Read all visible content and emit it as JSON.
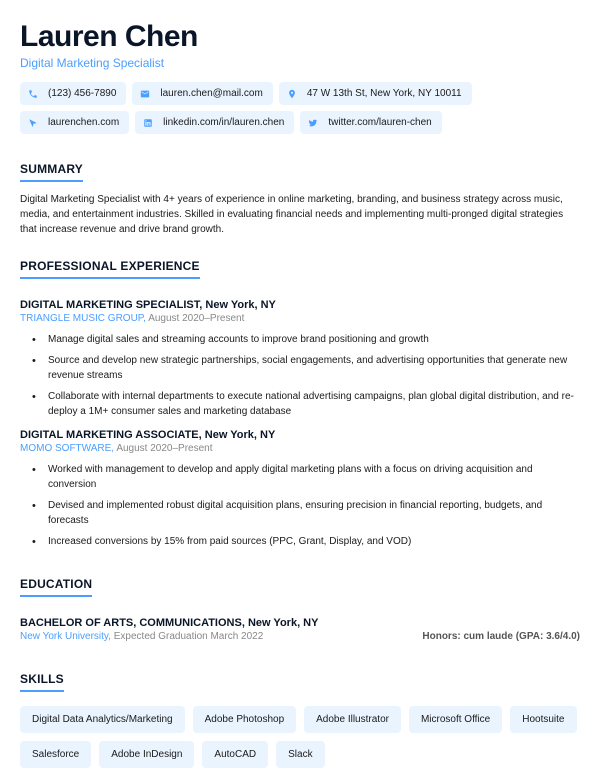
{
  "header": {
    "name": "Lauren Chen",
    "title": "Digital Marketing Specialist"
  },
  "contact": {
    "row1": [
      {
        "icon": "phone-icon",
        "text": "(123) 456-7890"
      },
      {
        "icon": "email-icon",
        "text": "lauren.chen@mail.com"
      },
      {
        "icon": "location-icon",
        "text": "47 W 13th St, New York, NY 10011"
      }
    ],
    "row2": [
      {
        "icon": "website-icon",
        "text": "laurenchen.com"
      },
      {
        "icon": "linkedin-icon",
        "text": "linkedin.com/in/lauren.chen"
      },
      {
        "icon": "twitter-icon",
        "text": "twitter.com/lauren-chen"
      }
    ]
  },
  "sections": {
    "summary_heading": "SUMMARY",
    "summary_text": "Digital Marketing Specialist with 4+ years of experience in online marketing, branding, and business strategy across music, media, and entertainment industries. Skilled in evaluating financial needs and implementing multi-pronged digital strategies that increase revenue and drive brand growth.",
    "experience_heading": "PROFESSIONAL EXPERIENCE",
    "education_heading": "EDUCATION",
    "skills_heading": "SKILLS"
  },
  "experience": [
    {
      "title": "DIGITAL MARKETING SPECIALIST,",
      "location": "New York, NY",
      "company": "TRIANGLE MUSIC GROUP,",
      "dates": "August 2020–Present",
      "bullets": [
        "Manage digital sales and streaming accounts to improve brand positioning and growth",
        "Source and develop new strategic partnerships, social engagements, and advertising opportunities that generate new revenue streams",
        "Collaborate with internal departments to execute national advertising campaigns, plan global digital distribution, and re-deploy a 1M+ consumer sales and marketing database"
      ]
    },
    {
      "title": "DIGITAL MARKETING ASSOCIATE,",
      "location": "New York, NY",
      "company": "MOMO SOFTWARE,",
      "dates": "August 2020–Present",
      "bullets": [
        "Worked with management to develop and apply digital marketing plans with a focus on driving acquisition and conversion",
        "Devised and implemented robust digital acquisition plans, ensuring precision in financial reporting, budgets, and forecasts",
        "Increased conversions by 15% from paid sources (PPC, Grant, Display, and VOD)"
      ]
    }
  ],
  "education": {
    "degree": "BACHELOR OF ARTS, COMMUNICATIONS,",
    "location": "New York, NY",
    "school": "New York University,",
    "dates": "Expected Graduation March 2022",
    "honors": "Honors: cum laude (GPA: 3.6/4.0)"
  },
  "skills": [
    "Digital Data Analytics/Marketing",
    "Adobe Photoshop",
    "Adobe Illustrator",
    "Microsoft Office",
    "Hootsuite",
    "Salesforce",
    "Adobe InDesign",
    "AutoCAD",
    "Slack"
  ]
}
